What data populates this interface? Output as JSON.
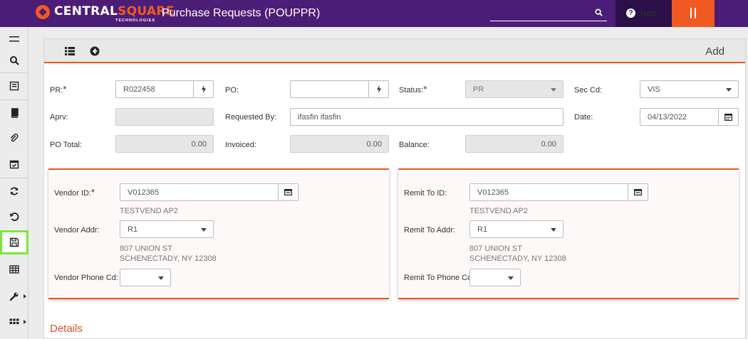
{
  "header": {
    "brand_left": "CENTRAL",
    "brand_right": "SQUARE",
    "brand_sub": "TECHNOLOGIES",
    "app_title": "Purchase Requests (POUPPR)",
    "search_value": "",
    "help_label": "Help"
  },
  "sidebar": {
    "items": [
      "menu-icon",
      "search-icon",
      "record-icon",
      "book-icon",
      "attach-icon",
      "calendar-check-icon",
      "refresh-icon",
      "undo-icon",
      "save-icon",
      "grid-icon",
      "wrench-icon",
      "apps-icon"
    ],
    "active": "save-icon"
  },
  "toolbar": {
    "mode": "Add"
  },
  "form": {
    "pr_label": "PR:",
    "pr_value": "R022458",
    "po_label": "PO:",
    "po_value": "",
    "status_label": "Status:",
    "status_value": "PR",
    "seccd_label": "Sec Cd:",
    "seccd_value": "VIS",
    "aprv_label": "Aprv:",
    "aprv_value": "",
    "requested_by_label": "Requested By:",
    "requested_by_value": "ifasfin ifasfin",
    "date_label": "Date:",
    "date_value": "04/13/2022",
    "po_total_label": "PO Total:",
    "po_total_value": "0.00",
    "invoiced_label": "Invoiced:",
    "invoiced_value": "0.00",
    "balance_label": "Balance:",
    "balance_value": "0.00"
  },
  "vendor": {
    "id_label": "Vendor ID:",
    "id_value": "V012365",
    "name": "TESTVEND AP2",
    "addr_label": "Vendor Addr:",
    "addr_value": "R1",
    "addr_line1": "807 UNION ST",
    "addr_line2": "SCHENECTADY, NY 12308",
    "phone_label": "Vendor Phone Cd:",
    "phone_value": ""
  },
  "remit": {
    "id_label": "Remit To ID:",
    "id_value": "V012365",
    "name": "TESTVEND AP2",
    "addr_label": "Remit To Addr:",
    "addr_value": "R1",
    "addr_line1": "807 UNION ST",
    "addr_line2": "SCHENECTADY, NY 12308",
    "phone_label": "Remit To Phone Cd:",
    "phone_value": ""
  },
  "details_title": "Details",
  "colors": {
    "header_bg": "#4b1d77",
    "accent": "#f05a22",
    "help_bg": "#2b0f48",
    "active_outline": "#79e83c"
  }
}
